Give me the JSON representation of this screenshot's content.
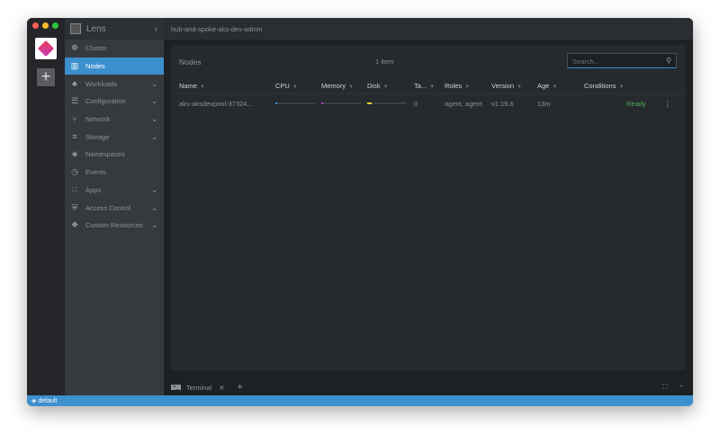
{
  "window": {
    "traffic_colors": [
      "#ff5f57",
      "#febc2e",
      "#28c840"
    ]
  },
  "sidebar": {
    "brand": "Lens",
    "items": [
      {
        "label": "Cluster",
        "icon": "helm-wheel-icon",
        "chevron": false
      },
      {
        "label": "Nodes",
        "icon": "nodes-icon",
        "chevron": false,
        "active": true
      },
      {
        "label": "Workloads",
        "icon": "workloads-icon",
        "chevron": true
      },
      {
        "label": "Configuration",
        "icon": "list-icon",
        "chevron": true
      },
      {
        "label": "Network",
        "icon": "network-icon",
        "chevron": true
      },
      {
        "label": "Storage",
        "icon": "database-icon",
        "chevron": true
      },
      {
        "label": "Namespaces",
        "icon": "layers-icon",
        "chevron": false
      },
      {
        "label": "Events",
        "icon": "clock-icon",
        "chevron": false
      },
      {
        "label": "Apps",
        "icon": "grid-icon",
        "chevron": true
      },
      {
        "label": "Access Control",
        "icon": "shield-icon",
        "chevron": true
      },
      {
        "label": "Custom Resources",
        "icon": "puzzle-icon",
        "chevron": true
      }
    ]
  },
  "topbar": {
    "cluster_name": "hub-and-spoke-aks-dev-admin"
  },
  "panel": {
    "title": "Nodes",
    "count": "1 item",
    "search_placeholder": "Search...",
    "columns": [
      "Name",
      "CPU",
      "Memory",
      "Disk",
      "Ta...",
      "Roles",
      "Version",
      "Age",
      "Conditions"
    ],
    "rows": [
      {
        "name": "aks-aksdevpool-37324...",
        "cpu": 2,
        "memory": 3,
        "disk": 12,
        "taints": "0",
        "roles": "agent, agent",
        "version": "v1.19.6",
        "age": "13m",
        "conditions": "Ready"
      }
    ],
    "colors": {
      "cpu": "#3d90ce",
      "memory": "#c837b8",
      "disk": "#e6d12a",
      "ready": "#4caf50"
    }
  },
  "terminal": {
    "label": "Terminal"
  },
  "status": {
    "namespace": "default"
  }
}
